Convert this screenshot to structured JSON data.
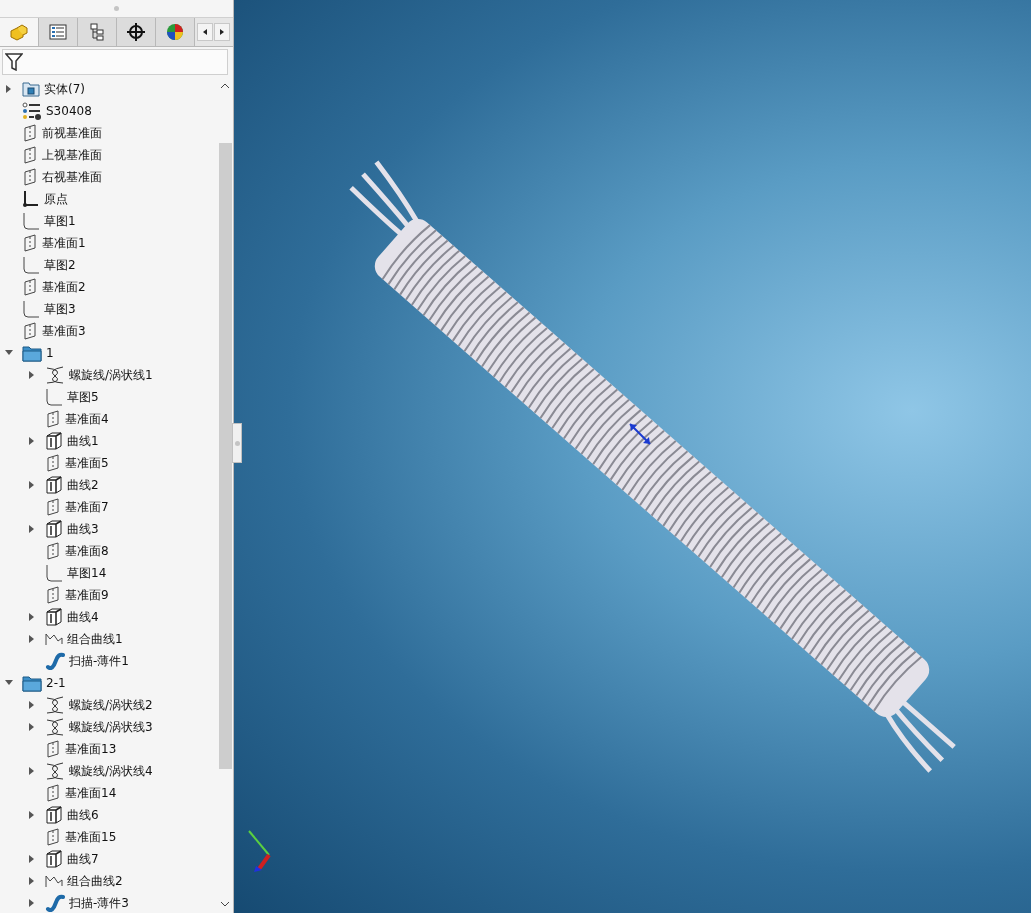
{
  "panel_tabs": [
    {
      "kind": "features",
      "selected": true
    },
    {
      "kind": "properties",
      "selected": false
    },
    {
      "kind": "configurations",
      "selected": false
    },
    {
      "kind": "dimxpert",
      "selected": false
    },
    {
      "kind": "appearance",
      "selected": false
    }
  ],
  "tree": [
    {
      "label": "实体(7)",
      "kind": "bodies",
      "expandable": true,
      "expanded": false
    },
    {
      "label": "S30408",
      "kind": "material",
      "expandable": false
    },
    {
      "label": "前视基准面",
      "kind": "plane",
      "expandable": false
    },
    {
      "label": "上视基准面",
      "kind": "plane",
      "expandable": false
    },
    {
      "label": "右视基准面",
      "kind": "plane",
      "expandable": false
    },
    {
      "label": "原点",
      "kind": "origin",
      "expandable": false
    },
    {
      "label": "草图1",
      "kind": "sketch",
      "expandable": false
    },
    {
      "label": "基准面1",
      "kind": "plane",
      "expandable": false
    },
    {
      "label": "草图2",
      "kind": "sketch",
      "expandable": false
    },
    {
      "label": "基准面2",
      "kind": "plane",
      "expandable": false
    },
    {
      "label": "草图3",
      "kind": "sketch",
      "expandable": false
    },
    {
      "label": "基准面3",
      "kind": "plane",
      "expandable": false
    },
    {
      "label": "1",
      "kind": "folder",
      "expandable": true,
      "expanded": true,
      "children": [
        {
          "label": "螺旋线/涡状线1",
          "kind": "helix",
          "expandable": true,
          "expanded": false
        },
        {
          "label": "草图5",
          "kind": "sketch",
          "expandable": false
        },
        {
          "label": "基准面4",
          "kind": "plane",
          "expandable": false
        },
        {
          "label": "曲线1",
          "kind": "curve",
          "expandable": true,
          "expanded": false
        },
        {
          "label": "基准面5",
          "kind": "plane",
          "expandable": false
        },
        {
          "label": "曲线2",
          "kind": "curve",
          "expandable": true,
          "expanded": false
        },
        {
          "label": "基准面7",
          "kind": "plane",
          "expandable": false
        },
        {
          "label": "曲线3",
          "kind": "curve",
          "expandable": true,
          "expanded": false
        },
        {
          "label": "基准面8",
          "kind": "plane",
          "expandable": false
        },
        {
          "label": "草图14",
          "kind": "sketch",
          "expandable": false
        },
        {
          "label": "基准面9",
          "kind": "plane",
          "expandable": false
        },
        {
          "label": "曲线4",
          "kind": "curve",
          "expandable": true,
          "expanded": false
        },
        {
          "label": "组合曲线1",
          "kind": "composite",
          "expandable": true,
          "expanded": false
        },
        {
          "label": "扫描-薄件1",
          "kind": "sweep",
          "expandable": false
        }
      ]
    },
    {
      "label": "2-1",
      "kind": "folder",
      "expandable": true,
      "expanded": true,
      "children": [
        {
          "label": "螺旋线/涡状线2",
          "kind": "helix",
          "expandable": true,
          "expanded": false
        },
        {
          "label": "螺旋线/涡状线3",
          "kind": "helix",
          "expandable": true,
          "expanded": false
        },
        {
          "label": "基准面13",
          "kind": "plane",
          "expandable": false
        },
        {
          "label": "螺旋线/涡状线4",
          "kind": "helix",
          "expandable": true,
          "expanded": false
        },
        {
          "label": "基准面14",
          "kind": "plane",
          "expandable": false
        },
        {
          "label": "曲线6",
          "kind": "curve",
          "expandable": true,
          "expanded": false
        },
        {
          "label": "基准面15",
          "kind": "plane",
          "expandable": false
        },
        {
          "label": "曲线7",
          "kind": "curve",
          "expandable": true,
          "expanded": false
        },
        {
          "label": "组合曲线2",
          "kind": "composite",
          "expandable": true,
          "expanded": false
        },
        {
          "label": "扫描-薄件3",
          "kind": "sweep",
          "expandable": true,
          "expanded": false
        }
      ]
    }
  ]
}
